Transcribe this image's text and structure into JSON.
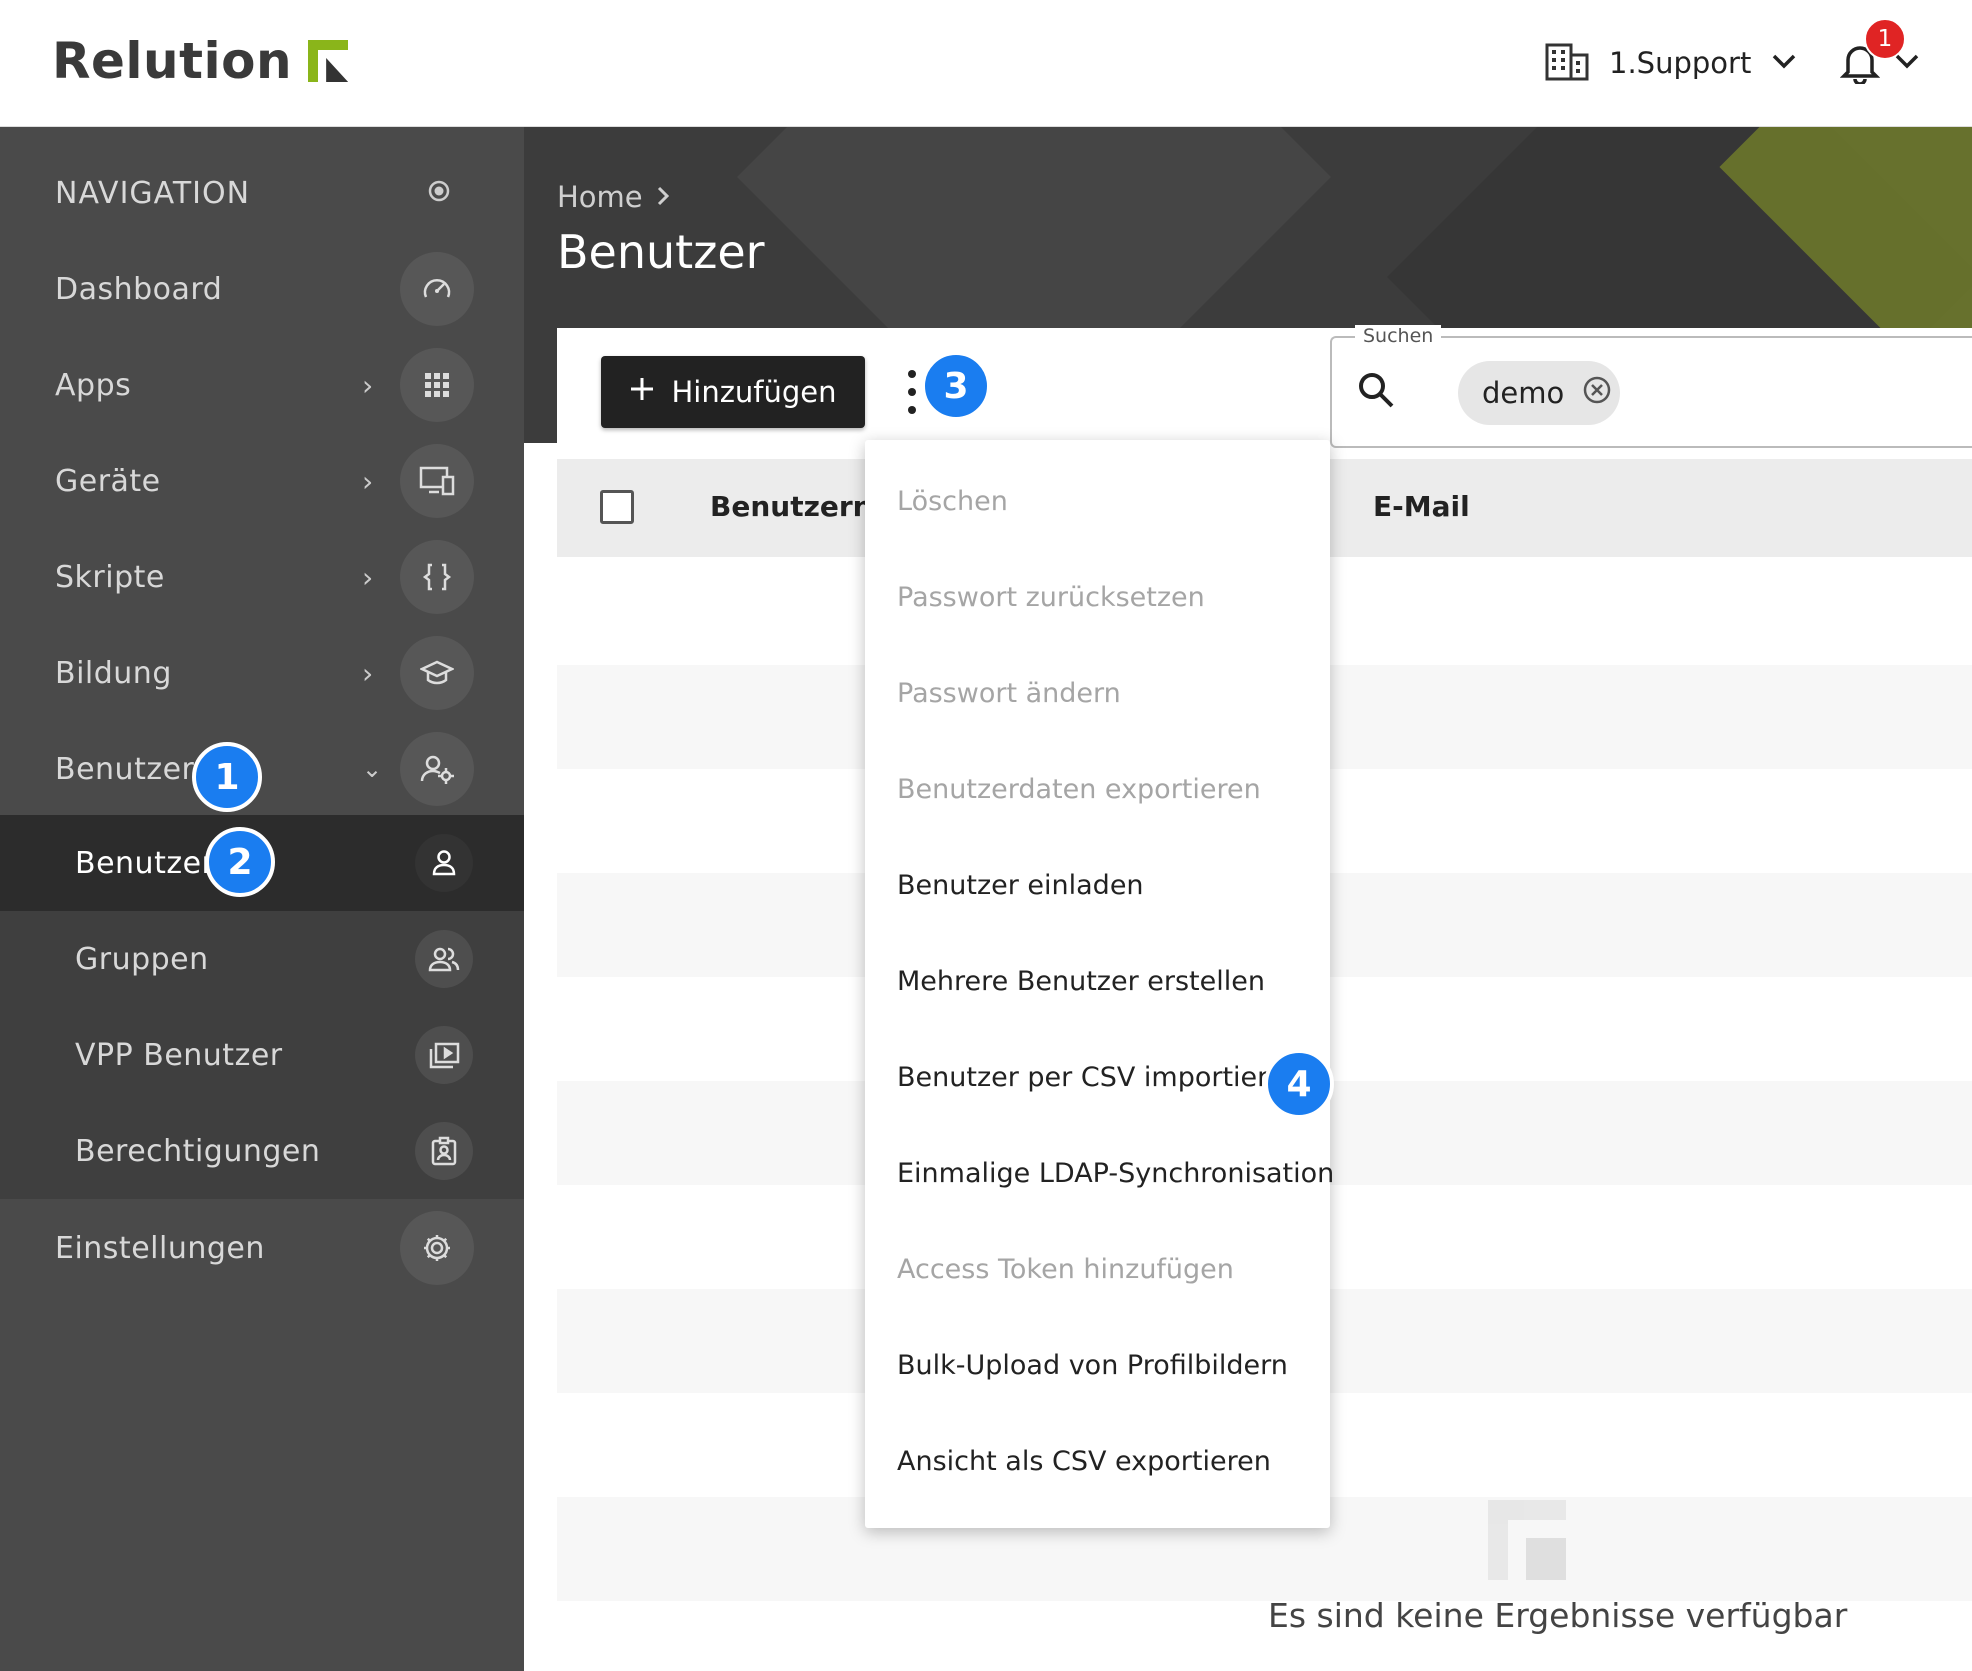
{
  "header": {
    "logo_text": "Relution",
    "tenant_name": "1.Support",
    "notification_count": "1"
  },
  "sidebar": {
    "section_title": "NAVIGATION",
    "items": [
      {
        "label": "Dashboard",
        "icon": "dashboard-gauge-icon"
      },
      {
        "label": "Apps",
        "icon": "apps-grid-icon"
      },
      {
        "label": "Geräte",
        "icon": "devices-icon"
      },
      {
        "label": "Skripte",
        "icon": "scripts-braces-icon"
      },
      {
        "label": "Bildung",
        "icon": "education-icon"
      },
      {
        "label": "Benutzer",
        "icon": "users-settings-icon"
      },
      {
        "label": "Einstellungen",
        "icon": "settings-gear-icon"
      }
    ],
    "sub_items": [
      {
        "label": "Benutzer",
        "icon": "user-icon"
      },
      {
        "label": "Gruppen",
        "icon": "group-icon"
      },
      {
        "label": "VPP Benutzer",
        "icon": "vpp-user-icon"
      },
      {
        "label": "Berechtigungen",
        "icon": "permissions-badge-icon"
      }
    ]
  },
  "steps": [
    "1",
    "2",
    "3",
    "4"
  ],
  "breadcrumb": {
    "home": "Home"
  },
  "page_title": "Benutzer",
  "toolbar": {
    "add_label": "Hinzufügen"
  },
  "search": {
    "legend": "Suchen",
    "chip_value": "demo"
  },
  "table": {
    "columns": [
      "Benutzername",
      "E-Mail"
    ],
    "empty_text": "Es sind keine Ergebnisse verfügbar"
  },
  "menu": {
    "items": [
      {
        "label": "Löschen",
        "enabled": false
      },
      {
        "label": "Passwort zurücksetzen",
        "enabled": false
      },
      {
        "label": "Passwort ändern",
        "enabled": false
      },
      {
        "label": "Benutzerdaten exportieren",
        "enabled": false
      },
      {
        "label": "Benutzer einladen",
        "enabled": true
      },
      {
        "label": "Mehrere Benutzer erstellen",
        "enabled": true
      },
      {
        "label": "Benutzer per CSV importieren",
        "enabled": true
      },
      {
        "label": "Einmalige LDAP-Synchronisation",
        "enabled": true
      },
      {
        "label": "Access Token hinzufügen",
        "enabled": false
      },
      {
        "label": "Bulk-Upload von Profilbildern",
        "enabled": true
      },
      {
        "label": "Ansicht als CSV exportieren",
        "enabled": true
      }
    ]
  },
  "colors": {
    "accent": "#8ab51a",
    "step_badge": "#1a7df0",
    "notification_badge": "#e02424",
    "sidebar_bg": "#4a4a4a"
  }
}
